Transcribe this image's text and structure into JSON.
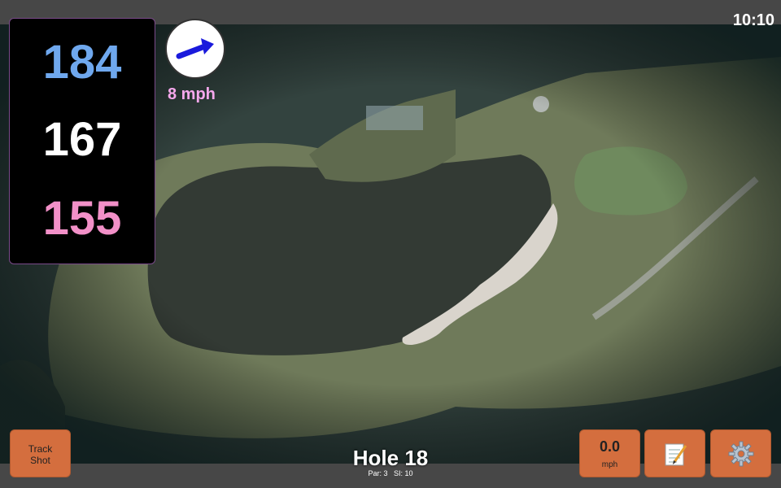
{
  "status": {
    "time": "10:10"
  },
  "distances": {
    "back": "184",
    "middle": "167",
    "front": "155"
  },
  "wind": {
    "speed": "8 mph",
    "direction": "north-east"
  },
  "hole": {
    "title": "Hole 18",
    "par": "Par: 3",
    "stroke_index": "SI: 10"
  },
  "buttons": {
    "track_shot_line1": "Track",
    "track_shot_line2": "Shot",
    "speed_value": "0.0",
    "speed_unit": "mph",
    "notes_icon": "notepad-icon",
    "settings_icon": "gear-icon"
  },
  "colors": {
    "back": "#6fa8ee",
    "middle": "#ffffff",
    "front": "#f290c8",
    "button": "#d46e3e",
    "wind_text": "#f5a8ec"
  }
}
